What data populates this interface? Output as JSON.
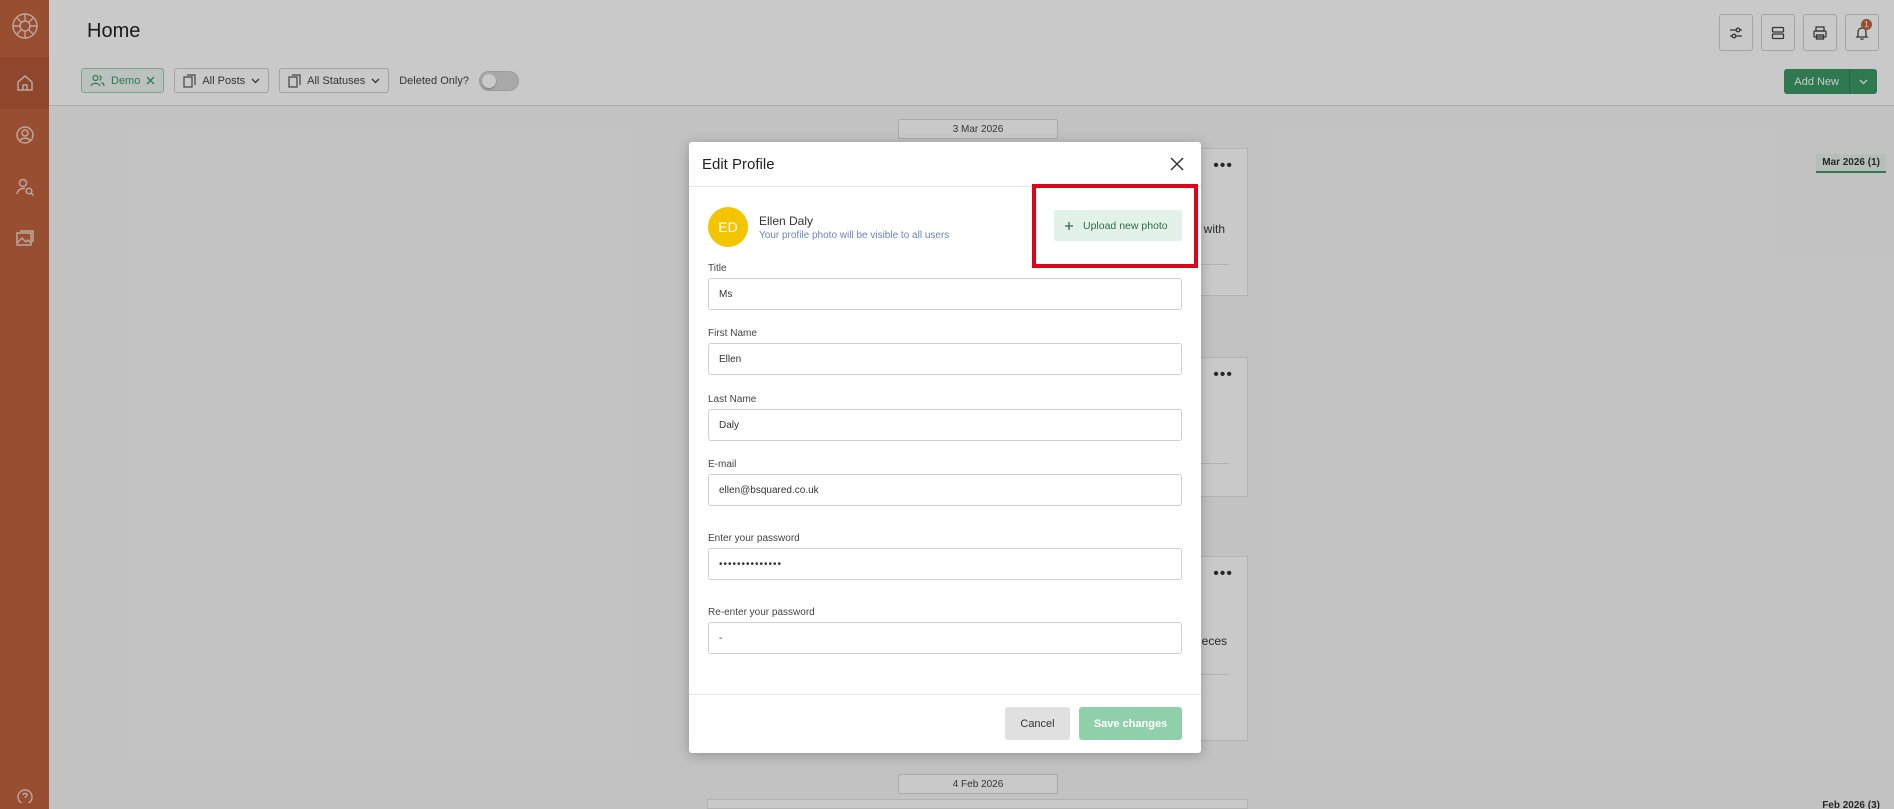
{
  "app": {
    "brand_color": "#c0643f",
    "accent_color": "#3b9a66"
  },
  "sidebar": {
    "items": [
      {
        "name": "home",
        "icon": "home-icon"
      },
      {
        "name": "profile",
        "icon": "user-circle-icon"
      },
      {
        "name": "user-search",
        "icon": "user-search-icon"
      },
      {
        "name": "gallery",
        "icon": "image-gallery-icon"
      }
    ],
    "help_icon": "help-icon"
  },
  "header": {
    "title": "Home",
    "notification_count": "1"
  },
  "filters": {
    "demo_label": "Demo",
    "posts_label": "All Posts",
    "statuses_label": "All Statuses",
    "deleted_label": "Deleted Only?"
  },
  "add_new": {
    "label": "Add New"
  },
  "feed": {
    "date_1": "3 Mar 2026",
    "date_2": "4 Feb 2026",
    "card_1_text": "with",
    "card_3_text": "pieces",
    "month_mar": "Mar 2026 (1)",
    "month_feb": "Feb 2026 (3)"
  },
  "modal": {
    "title": "Edit Profile",
    "avatar_initials": "ED",
    "user_name": "Ellen Daly",
    "photo_hint": "Your profile photo will be visible to all users",
    "upload_label": "Upload new photo",
    "fields": {
      "title": {
        "label": "Title",
        "value": "Ms"
      },
      "first_name": {
        "label": "First Name",
        "value": "Ellen"
      },
      "last_name": {
        "label": "Last Name",
        "value": "Daly"
      },
      "email": {
        "label": "E-mail",
        "value": "ellen@bsquared.co.uk"
      },
      "password": {
        "label": "Enter your password",
        "value": "••••••••••••••"
      },
      "password_confirm": {
        "label": "Re-enter your password",
        "value": "-"
      }
    },
    "cancel_label": "Cancel",
    "save_label": "Save changes"
  }
}
